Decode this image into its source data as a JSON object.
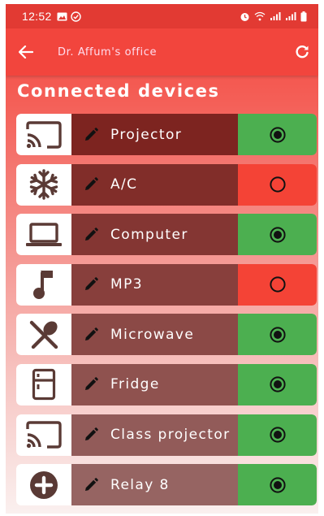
{
  "status_bar": {
    "time": "12:52"
  },
  "app_bar": {
    "title": "Dr. Affum's office",
    "back_icon": "arrow-left-icon",
    "refresh_icon": "refresh-icon"
  },
  "heading": "Connected devices",
  "colors": {
    "on": "#4caf50",
    "off": "#f44336",
    "name_bg_top": "#7d2420",
    "icon": "#5a3a35"
  },
  "devices": [
    {
      "label": "Projector",
      "icon": "cast-icon",
      "on": true
    },
    {
      "label": "A/C",
      "icon": "snowflake-icon",
      "on": false
    },
    {
      "label": "Computer",
      "icon": "laptop-icon",
      "on": true
    },
    {
      "label": "MP3",
      "icon": "music-note-icon",
      "on": false
    },
    {
      "label": "Microwave",
      "icon": "utensils-icon",
      "on": true
    },
    {
      "label": "Fridge",
      "icon": "fridge-icon",
      "on": true
    },
    {
      "label": "Class projector",
      "icon": "cast-icon",
      "on": true
    },
    {
      "label": "Relay 8",
      "icon": "plus-circle-icon",
      "on": true
    }
  ]
}
